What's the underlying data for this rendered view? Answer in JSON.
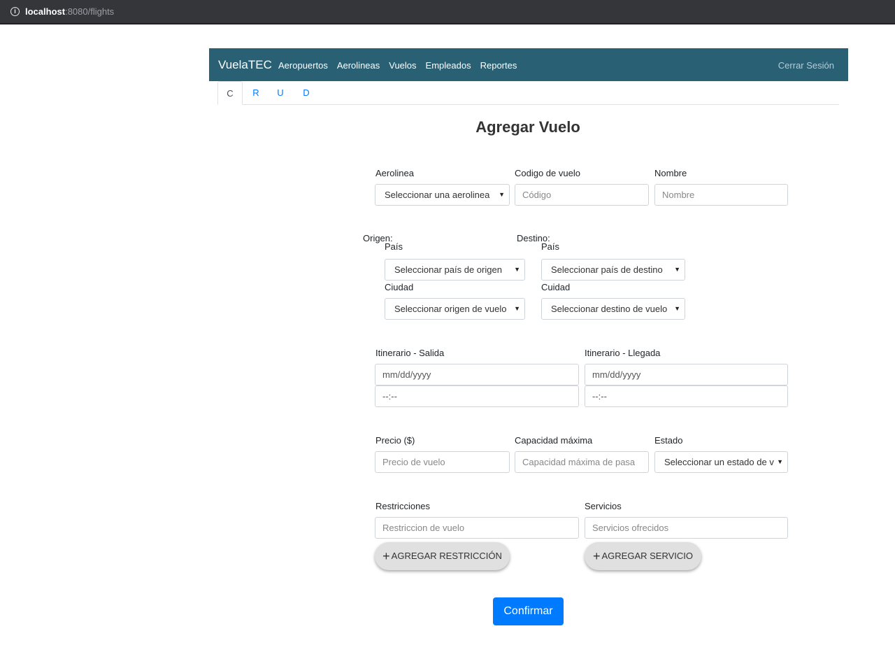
{
  "browser": {
    "url_host": "localhost",
    "url_rest": ":8080/flights"
  },
  "navbar": {
    "brand": "VuelaTEC",
    "links": [
      "Aeropuertos",
      "Aerolineas",
      "Vuelos",
      "Empleados",
      "Reportes"
    ],
    "logout": "Cerrar Sesión"
  },
  "tabs": [
    "C",
    "R",
    "U",
    "D"
  ],
  "page_title": "Agregar Vuelo",
  "form": {
    "airline_label": "Aerolinea",
    "airline_select": "Seleccionar una aerolinea",
    "code_label": "Codigo de vuelo",
    "code_placeholder": "Código",
    "name_label": "Nombre",
    "name_placeholder": "Nombre",
    "origin_label": "Origen:",
    "origin_country_label": "País",
    "origin_country_select": "Seleccionar país de origen",
    "origin_city_label": "Ciudad",
    "origin_city_select": "Seleccionar origen de vuelo",
    "dest_label": "Destino:",
    "dest_country_label": "País",
    "dest_country_select": "Seleccionar país de destino",
    "dest_city_label": "Cuidad",
    "dest_city_select": "Seleccionar destino de vuelo",
    "departure_label": "Itinerario - Salida",
    "departure_date": "mm/dd/yyyy",
    "departure_time": "--:--",
    "arrival_label": "Itinerario - Llegada",
    "arrival_date": "mm/dd/yyyy",
    "arrival_time": "--:--",
    "price_label": "Precio ($)",
    "price_placeholder": "Precio de vuelo",
    "capacity_label": "Capacidad máxima",
    "capacity_placeholder": "Capacidad máxima de pasa",
    "status_label": "Estado",
    "status_select": "Seleccionar un estado de v",
    "restrictions_label": "Restricciones",
    "restrictions_placeholder": "Restriccion de vuelo",
    "add_restriction": "AGREGAR RESTRICCIÓN",
    "services_label": "Servicios",
    "services_placeholder": "Servicios ofrecidos",
    "add_service": "AGREGAR SERVICIO",
    "confirm": "Confirmar"
  }
}
